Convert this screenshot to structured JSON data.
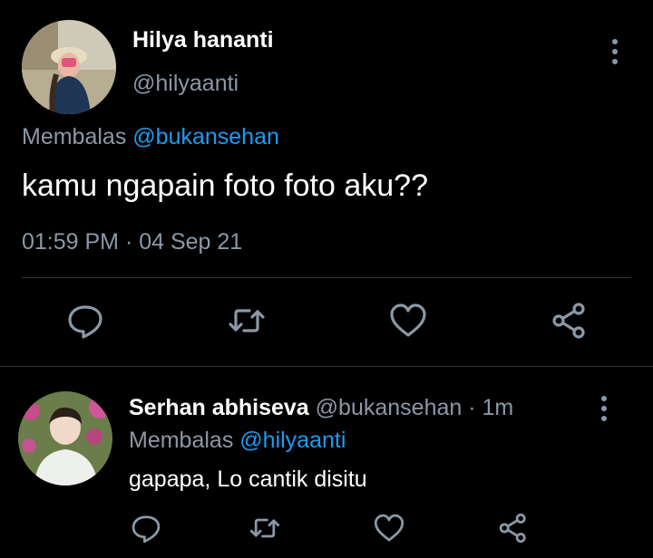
{
  "main_tweet": {
    "display_name": "Hilya hananti",
    "handle": "@hilyaanti",
    "reply_prefix": "Membalas",
    "reply_mention": "@bukansehan",
    "text": "kamu ngapain foto foto aku??",
    "timestamp": "01:59 PM · 04 Sep 21",
    "actions": [
      "reply-icon",
      "retweet-icon",
      "like-icon",
      "share-icon"
    ]
  },
  "reply_tweet": {
    "display_name": "Serhan abhiseva",
    "handle": "@bukansehan",
    "separator": " · ",
    "age": "1m",
    "reply_prefix": "Membalas",
    "reply_mention": "@hilyaanti",
    "text": "gapapa, Lo cantik disitu",
    "actions": [
      "reply-icon",
      "retweet-icon",
      "like-icon",
      "share-icon"
    ]
  },
  "colors": {
    "background": "#000000",
    "primary_text": "#ffffff",
    "secondary_text": "#8b98a5",
    "accent": "#1d9bf0",
    "divider": "#2f3336"
  }
}
